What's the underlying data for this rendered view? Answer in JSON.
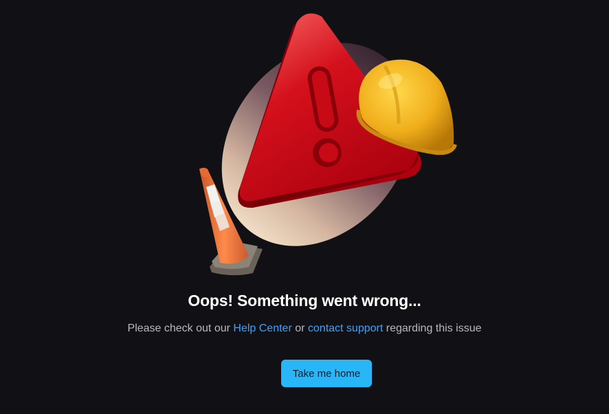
{
  "error": {
    "title": "Oops! Something went wrong...",
    "message_prefix": "Please check out our ",
    "help_center_link": "Help Center",
    "message_middle": " or ",
    "contact_support_link": "contact support",
    "message_suffix": " regarding this issue"
  },
  "actions": {
    "home_button_label": "Take me home"
  },
  "illustration": {
    "icons": [
      "warning-triangle-icon",
      "hard-hat-icon",
      "traffic-cone-icon"
    ]
  },
  "colors": {
    "background": "#111115",
    "accent_link": "#3aa3ff",
    "button_background": "#29b6f6",
    "warning_red": "#d0101a",
    "hard_hat_yellow": "#f2b21e",
    "cone_orange": "#f07a3a"
  }
}
